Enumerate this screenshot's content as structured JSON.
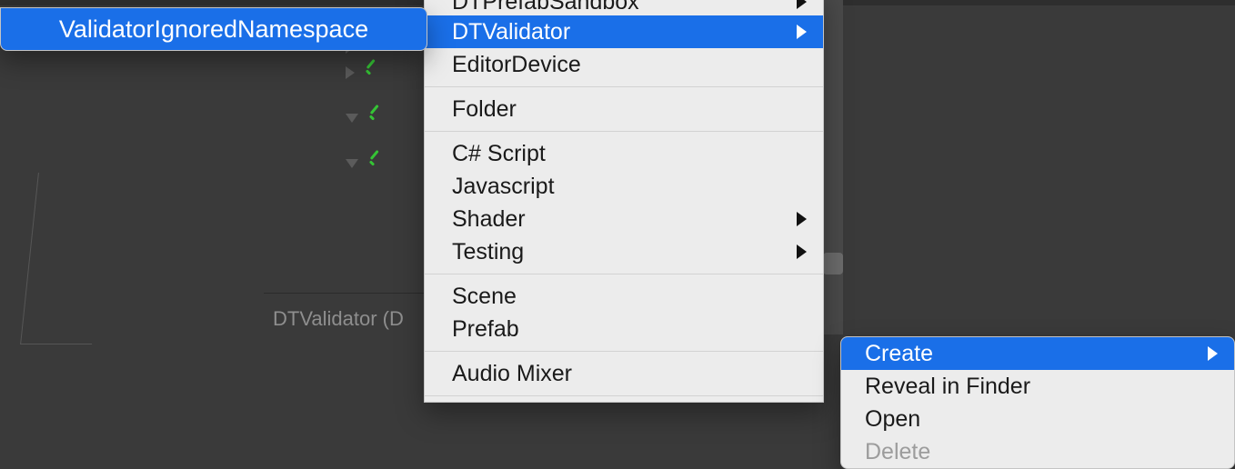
{
  "path_label": "DTValidator (D",
  "hier_rows": [
    {
      "arrow": "none",
      "check": true
    },
    {
      "arrow": "right",
      "check": true
    },
    {
      "arrow": "right",
      "check": true
    },
    {
      "arrow": "none",
      "check": false,
      "spacer": true
    },
    {
      "arrow": "down",
      "check": true
    },
    {
      "arrow": "none",
      "check": false,
      "spacer": true
    },
    {
      "arrow": "down",
      "check": true
    }
  ],
  "menu_left": {
    "item": "ValidatorIgnoredNamespace"
  },
  "menu_mid": {
    "top_cut": {
      "label": "DTPrefabSandbox",
      "has_sub": true
    },
    "items": [
      {
        "label": "DTValidator",
        "has_sub": true,
        "selected": true
      },
      {
        "label": "EditorDevice",
        "has_sub": false
      },
      {
        "sep": true
      },
      {
        "label": "Folder",
        "has_sub": false
      },
      {
        "sep": true
      },
      {
        "label": "C# Script",
        "has_sub": false
      },
      {
        "label": "Javascript",
        "has_sub": false
      },
      {
        "label": "Shader",
        "has_sub": true
      },
      {
        "label": "Testing",
        "has_sub": true
      },
      {
        "sep": true
      },
      {
        "label": "Scene",
        "has_sub": false
      },
      {
        "label": "Prefab",
        "has_sub": false
      },
      {
        "sep": true
      },
      {
        "label": "Audio Mixer",
        "has_sub": false
      }
    ]
  },
  "menu_right": {
    "items": [
      {
        "label": "Create",
        "has_sub": true,
        "selected": true
      },
      {
        "label": "Reveal in Finder"
      },
      {
        "label": "Open"
      },
      {
        "label": "Delete",
        "disabled": true
      }
    ]
  }
}
